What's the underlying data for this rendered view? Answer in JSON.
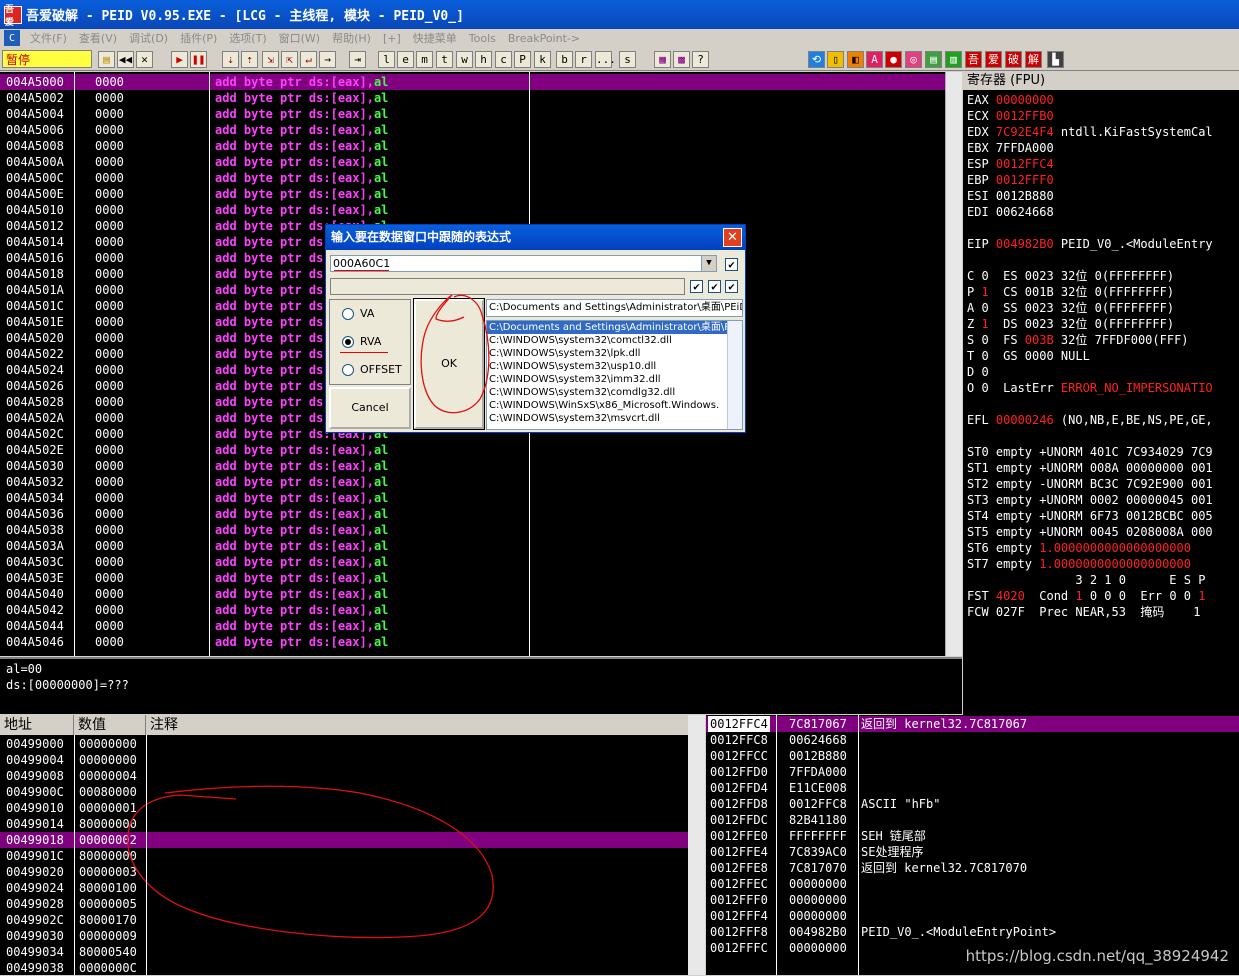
{
  "window": {
    "title": "吾爱破解 - PEID V0.95.EXE - [LCG -  主线程, 模块 - PEID_V0_]",
    "logo_text": "吾爱"
  },
  "menu": [
    "文件(F)",
    "查看(V)",
    "调试(D)",
    "插件(P)",
    "选项(T)",
    "窗口(W)",
    "帮助(H)",
    "[+]",
    "快捷菜单",
    "Tools",
    "BreakPoint->"
  ],
  "status": "暂停",
  "toolbar_letters": [
    "l",
    "e",
    "m",
    "t",
    "w",
    "h",
    "c",
    "P",
    "k",
    "b",
    "r",
    "...",
    "s"
  ],
  "disasm": {
    "rows": [
      {
        "addr": "004A5000",
        "hex": "0000"
      },
      {
        "addr": "004A5002",
        "hex": "0000"
      },
      {
        "addr": "004A5004",
        "hex": "0000"
      },
      {
        "addr": "004A5006",
        "hex": "0000"
      },
      {
        "addr": "004A5008",
        "hex": "0000"
      },
      {
        "addr": "004A500A",
        "hex": "0000"
      },
      {
        "addr": "004A500C",
        "hex": "0000"
      },
      {
        "addr": "004A500E",
        "hex": "0000"
      },
      {
        "addr": "004A5010",
        "hex": "0000"
      },
      {
        "addr": "004A5012",
        "hex": "0000"
      },
      {
        "addr": "004A5014",
        "hex": "0000"
      },
      {
        "addr": "004A5016",
        "hex": "0000"
      },
      {
        "addr": "004A5018",
        "hex": "0000"
      },
      {
        "addr": "004A501A",
        "hex": "0000"
      },
      {
        "addr": "004A501C",
        "hex": "0000"
      },
      {
        "addr": "004A501E",
        "hex": "0000"
      },
      {
        "addr": "004A5020",
        "hex": "0000"
      },
      {
        "addr": "004A5022",
        "hex": "0000"
      },
      {
        "addr": "004A5024",
        "hex": "0000"
      },
      {
        "addr": "004A5026",
        "hex": "0000"
      },
      {
        "addr": "004A5028",
        "hex": "0000"
      },
      {
        "addr": "004A502A",
        "hex": "0000"
      },
      {
        "addr": "004A502C",
        "hex": "0000"
      },
      {
        "addr": "004A502E",
        "hex": "0000"
      },
      {
        "addr": "004A5030",
        "hex": "0000"
      },
      {
        "addr": "004A5032",
        "hex": "0000"
      },
      {
        "addr": "004A5034",
        "hex": "0000"
      },
      {
        "addr": "004A5036",
        "hex": "0000"
      },
      {
        "addr": "004A5038",
        "hex": "0000"
      },
      {
        "addr": "004A503A",
        "hex": "0000"
      },
      {
        "addr": "004A503C",
        "hex": "0000"
      },
      {
        "addr": "004A503E",
        "hex": "0000"
      },
      {
        "addr": "004A5040",
        "hex": "0000"
      },
      {
        "addr": "004A5042",
        "hex": "0000"
      },
      {
        "addr": "004A5044",
        "hex": "0000"
      },
      {
        "addr": "004A5046",
        "hex": "0000"
      }
    ],
    "instr_op": "add byte ptr ds:[eax],",
    "instr_reg": "al",
    "hint_lines": [
      "al=00",
      "ds:[00000000]=???"
    ]
  },
  "registers": {
    "header": "寄存器 (FPU)",
    "lines": [
      [
        {
          "t": "EAX "
        },
        {
          "t": "00000000",
          "r": 1
        }
      ],
      [
        {
          "t": "ECX "
        },
        {
          "t": "0012FFB0",
          "r": 1
        }
      ],
      [
        {
          "t": "EDX "
        },
        {
          "t": "7C92E4F4",
          "r": 1
        },
        {
          "t": " ntdll.KiFastSystemCal"
        }
      ],
      [
        {
          "t": "EBX 7FFDA000"
        }
      ],
      [
        {
          "t": "ESP "
        },
        {
          "t": "0012FFC4",
          "r": 1
        }
      ],
      [
        {
          "t": "EBP "
        },
        {
          "t": "0012FFF0",
          "r": 1
        }
      ],
      [
        {
          "t": "ESI 0012B880"
        }
      ],
      [
        {
          "t": "EDI 00624668"
        }
      ],
      [
        {
          "t": ""
        }
      ],
      [
        {
          "t": "EIP "
        },
        {
          "t": "004982B0",
          "r": 1
        },
        {
          "t": " PEID_V0_.<ModuleEntry"
        }
      ],
      [
        {
          "t": ""
        }
      ],
      [
        {
          "t": "C 0  ES 0023 32位 0(FFFFFFFF)"
        }
      ],
      [
        {
          "t": "P "
        },
        {
          "t": "1",
          "r": 1
        },
        {
          "t": "  CS 001B 32位 0(FFFFFFFF)"
        }
      ],
      [
        {
          "t": "A 0  SS 0023 32位 0(FFFFFFFF)"
        }
      ],
      [
        {
          "t": "Z "
        },
        {
          "t": "1",
          "r": 1
        },
        {
          "t": "  DS 0023 32位 0(FFFFFFFF)"
        }
      ],
      [
        {
          "t": "S 0  FS "
        },
        {
          "t": "003B",
          "r": 1
        },
        {
          "t": " 32位 7FFDF000(FFF)"
        }
      ],
      [
        {
          "t": "T 0  GS 0000 NULL"
        }
      ],
      [
        {
          "t": "D 0"
        }
      ],
      [
        {
          "t": "O 0  LastErr "
        },
        {
          "t": "ERROR_NO_IMPERSONATIO",
          "r": 1
        }
      ],
      [
        {
          "t": ""
        }
      ],
      [
        {
          "t": "EFL "
        },
        {
          "t": "00000246",
          "r": 1
        },
        {
          "t": " (NO,NB,E,BE,NS,PE,GE,"
        }
      ],
      [
        {
          "t": ""
        }
      ],
      [
        {
          "t": "ST0 empty +UNORM 401C 7C934029 7C9"
        }
      ],
      [
        {
          "t": "ST1 empty +UNORM 008A 00000000 001"
        }
      ],
      [
        {
          "t": "ST2 empty -UNORM BC3C 7C92E900 001"
        }
      ],
      [
        {
          "t": "ST3 empty +UNORM 0002 00000045 001"
        }
      ],
      [
        {
          "t": "ST4 empty +UNORM 6F73 0012BCBC 005"
        }
      ],
      [
        {
          "t": "ST5 empty +UNORM 0045 0208008A 000"
        }
      ],
      [
        {
          "t": "ST6 empty "
        },
        {
          "t": "1.0000000000000000000",
          "r": 1
        }
      ],
      [
        {
          "t": "ST7 empty "
        },
        {
          "t": "1.0000000000000000000",
          "r": 1
        }
      ],
      [
        {
          "t": "               3 2 1 0      E S P"
        }
      ],
      [
        {
          "t": "FST "
        },
        {
          "t": "4020",
          "r": 1
        },
        {
          "t": "  Cond "
        },
        {
          "t": "1",
          "r": 1
        },
        {
          "t": " 0 0 0  Err 0 0 "
        },
        {
          "t": "1",
          "r": 1
        }
      ],
      [
        {
          "t": "FCW 027F  Prec NEAR,53  掩码    1"
        }
      ]
    ]
  },
  "dump": {
    "headers": [
      "地址",
      "数值",
      "注释"
    ],
    "rows": [
      [
        "00499000",
        "00000000"
      ],
      [
        "00499004",
        "00000000"
      ],
      [
        "00499008",
        "00000004"
      ],
      [
        "0049900C",
        "00080000"
      ],
      [
        "00499010",
        "00000001"
      ],
      [
        "00499014",
        "80000000"
      ],
      [
        "00499018",
        "00000002"
      ],
      [
        "0049901C",
        "80000000"
      ],
      [
        "00499020",
        "00000003"
      ],
      [
        "00499024",
        "80000100"
      ],
      [
        "00499028",
        "00000005"
      ],
      [
        "0049902C",
        "80000170"
      ],
      [
        "00499030",
        "00000009"
      ],
      [
        "00499034",
        "80000540"
      ],
      [
        "00499038",
        "0000000C"
      ]
    ]
  },
  "stack": {
    "rows": [
      [
        "0012FFC4",
        "7C817067",
        "返回到 kernel32.7C817067"
      ],
      [
        "0012FFC8",
        "00624668",
        ""
      ],
      [
        "0012FFCC",
        "0012B880",
        ""
      ],
      [
        "0012FFD0",
        "7FFDA000",
        ""
      ],
      [
        "0012FFD4",
        "E11CE008",
        ""
      ],
      [
        "0012FFD8",
        "0012FFC8",
        "ASCII \"hFb\""
      ],
      [
        "0012FFDC",
        "82B41180",
        ""
      ],
      [
        "0012FFE0",
        "FFFFFFFF",
        "SEH 链尾部"
      ],
      [
        "0012FFE4",
        "7C839AC0",
        "SE处理程序"
      ],
      [
        "0012FFE8",
        "7C817070",
        "返回到 kernel32.7C817070"
      ],
      [
        "0012FFEC",
        "00000000",
        ""
      ],
      [
        "0012FFF0",
        "00000000",
        ""
      ],
      [
        "0012FFF4",
        "00000000",
        ""
      ],
      [
        "0012FFF8",
        "004982B0",
        "PEID_V0_.<ModuleEntryPoint>"
      ],
      [
        "0012FFFC",
        "00000000",
        ""
      ]
    ]
  },
  "dialog": {
    "title": "输入要在数据窗口中跟随的表达式",
    "expression": "000A60C1",
    "path_field": "C:\\Documents and Settings\\Administrator\\桌面\\PEiD",
    "list": [
      "C:\\Documents and Settings\\Administrator\\桌面\\PEiD",
      "C:\\WINDOWS\\system32\\comctl32.dll",
      "C:\\WINDOWS\\system32\\lpk.dll",
      "C:\\WINDOWS\\system32\\usp10.dll",
      "C:\\WINDOWS\\system32\\imm32.dll",
      "C:\\WINDOWS\\system32\\comdlg32.dll",
      "C:\\WINDOWS\\WinSxS\\x86_Microsoft.Windows.",
      "C:\\WINDOWS\\system32\\msvcrt.dll"
    ],
    "radio": [
      "VA",
      "RVA",
      "OFFSET"
    ],
    "ok": "OK",
    "cancel": "Cancel"
  },
  "watermark": "https://blog.csdn.net/qq_38924942"
}
